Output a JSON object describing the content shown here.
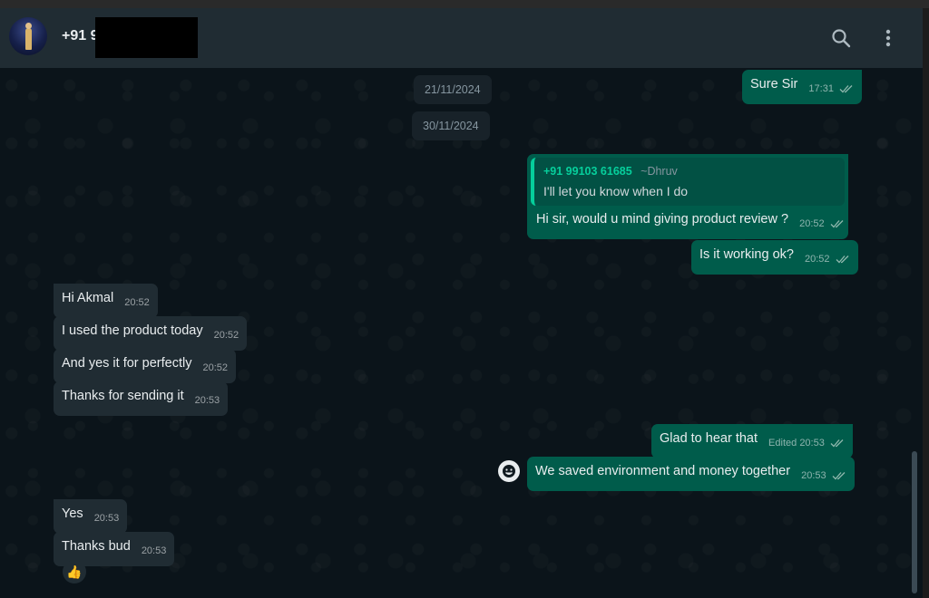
{
  "header": {
    "contact_name": "+91 9",
    "search_icon": "search-icon",
    "menu_icon": "more-vertical-icon"
  },
  "dates": [
    "21/11/2024",
    "30/11/2024"
  ],
  "messages": {
    "m1": {
      "text": "Sure Sir",
      "time": "17:31"
    },
    "m2": {
      "quote_number": "+91 99103 61685",
      "quote_alias": "~Dhruv",
      "quote_text": "I'll let you know when I do",
      "text": "Hi sir, would u mind giving product review ?",
      "time": "20:52"
    },
    "m3": {
      "text": "Is it working ok?",
      "time": "20:52"
    },
    "m4": {
      "text": "Hi Akmal",
      "time": "20:52"
    },
    "m5": {
      "text": "I used the product today",
      "time": "20:52"
    },
    "m6": {
      "text": "And yes it for perfectly",
      "time": "20:52"
    },
    "m7": {
      "text": "Thanks for sending it",
      "time": "20:53"
    },
    "m8": {
      "text": "Glad to hear that",
      "edited": "Edited",
      "time": "20:53"
    },
    "m9": {
      "text": "We saved environment and money together",
      "time": "20:53"
    },
    "m10": {
      "text": "Yes",
      "time": "20:53"
    },
    "m11": {
      "text": "Thanks bud",
      "time": "20:53",
      "reaction": "👍"
    }
  },
  "colors": {
    "background": "#0b141a",
    "header": "#202c33",
    "incoming": "#202c33",
    "outgoing": "#005c4b",
    "accent": "#06cf9c"
  }
}
